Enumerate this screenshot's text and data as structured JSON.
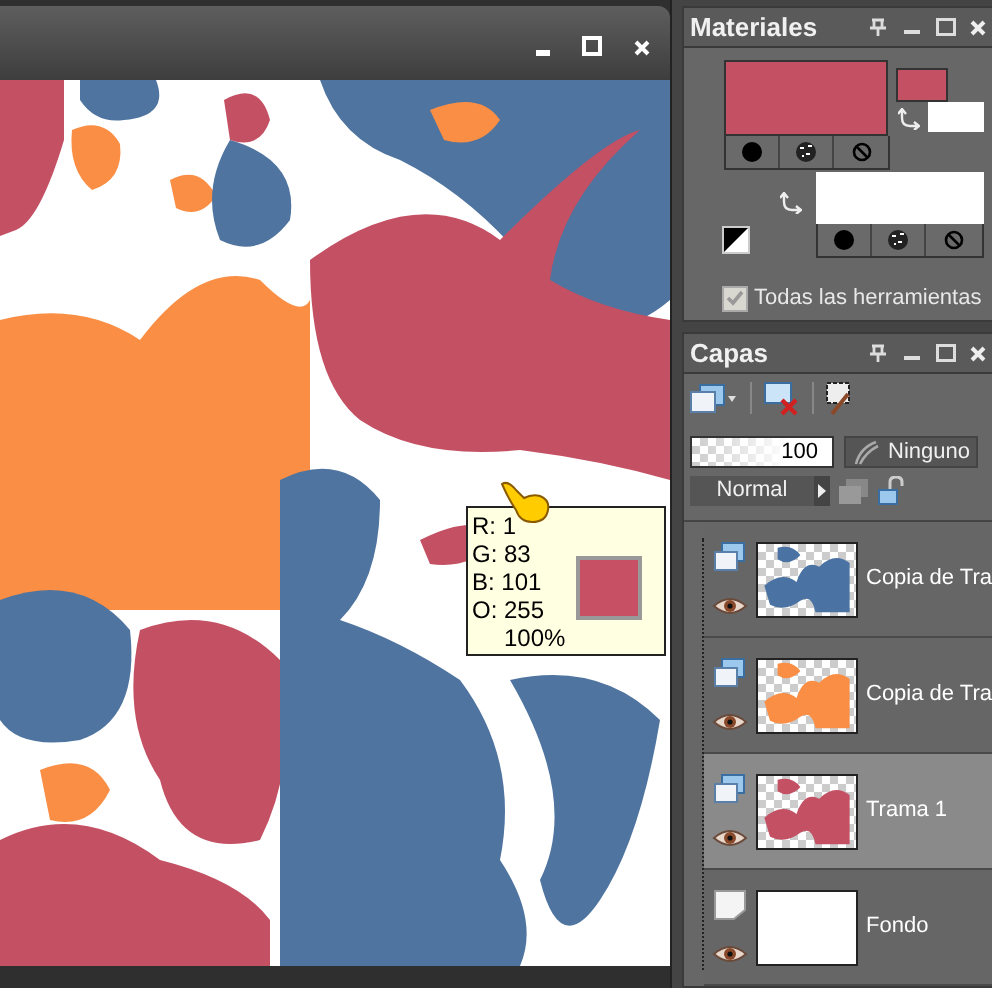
{
  "tooltip": {
    "lines": [
      "R: 1",
      "G: 83",
      "B: 101",
      "O: 255"
    ],
    "swatch_label": "100%"
  },
  "materials": {
    "title": "Materiales",
    "all_tools": {
      "label": "Todas las herramientas",
      "checked": true
    }
  },
  "layers": {
    "title": "Capas",
    "opacity": "100",
    "mask": "Ninguno",
    "blend_mode": "Normal",
    "items": [
      {
        "name": "Copia de Tra",
        "kind": "raster",
        "color": "#4a73a3",
        "selected": false,
        "visible": true
      },
      {
        "name": "Copia de Tra",
        "kind": "raster",
        "color": "#f98e44",
        "selected": false,
        "visible": true
      },
      {
        "name": "Trama 1",
        "kind": "raster",
        "color": "#c45064",
        "selected": true,
        "visible": true
      },
      {
        "name": "Fondo",
        "kind": "background",
        "color": "#ffffff",
        "selected": false,
        "visible": true
      }
    ]
  }
}
